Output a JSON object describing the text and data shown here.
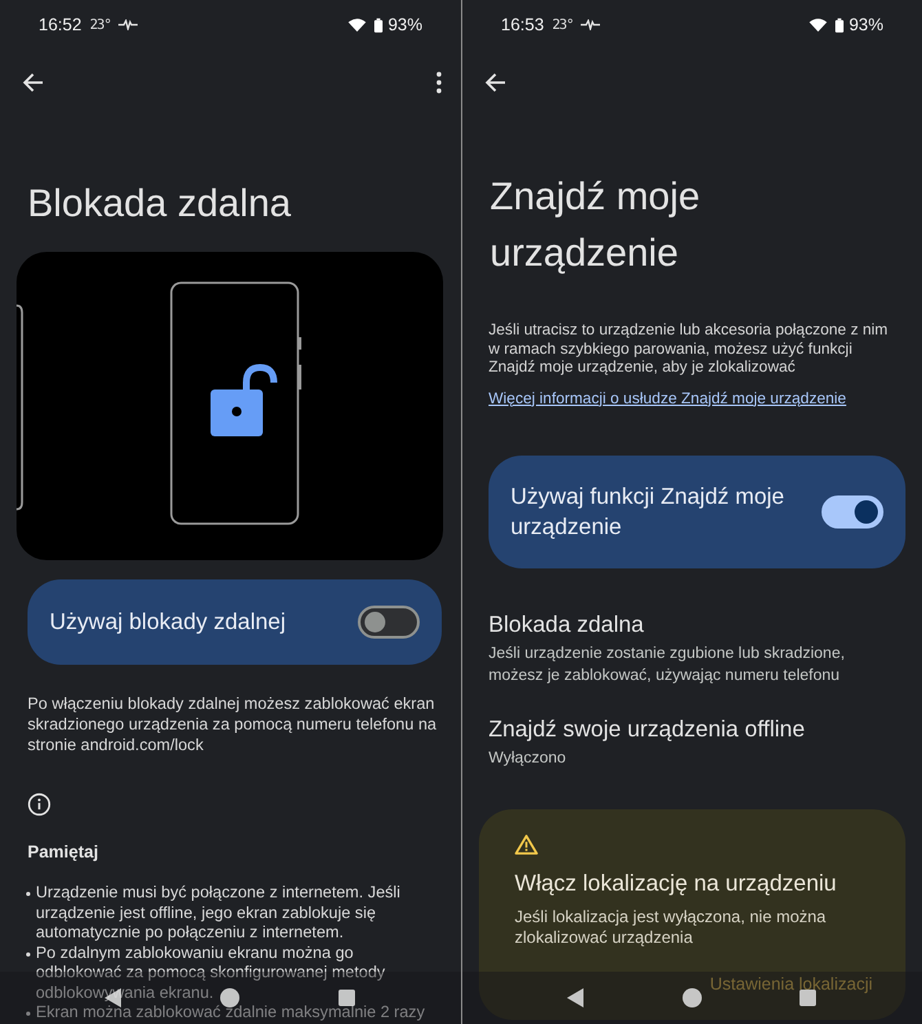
{
  "screens": [
    {
      "status": {
        "time": "16:52",
        "temperature": "23°",
        "battery": "93%"
      },
      "menu_button": true,
      "title": "Blokada zdalna",
      "blocks": [
        {
          "kind": "illustration"
        },
        {
          "kind": "switch",
          "label": "Używaj blokady zdalnej",
          "on": false
        },
        {
          "kind": "text",
          "text": "Po włączeniu blokady zdalnej możesz zablokować ekran skradzionego urządzenia za pomocą numeru telefonu na stronie android.com/lock"
        },
        {
          "kind": "info"
        },
        {
          "kind": "heading",
          "text": "Pamiętaj"
        },
        {
          "kind": "bullets",
          "items": [
            "Urządzenie musi być połączone z internetem. Jeśli urządzenie jest offline, jego ekran zablokuje się automatycznie po połączeniu z internetem.",
            "Po zdalnym zablokowaniu ekranu można go odblokować za pomocą skonfigurowanej metody odblokowywania ekranu.",
            "Ekran można zablokować zdalnie maksymalnie 2 razy"
          ]
        }
      ]
    },
    {
      "status": {
        "time": "16:53",
        "temperature": "23°",
        "battery": "93%"
      },
      "menu_button": false,
      "title": "Znajdź moje urządzenie",
      "blocks": [
        {
          "kind": "small_text",
          "text": "Jeśli utracisz to urządzenie lub akcesoria połączone z nim w ramach szybkiego parowania, możesz użyć funkcji Znajdź moje urządzenie, aby je zlokalizować"
        },
        {
          "kind": "link",
          "text": "Więcej informacji o usłudze Znajdź moje urządzenie"
        },
        {
          "kind": "switch",
          "label": "Używaj funkcji Znajdź moje urządzenie",
          "on": true
        },
        {
          "kind": "setting",
          "title": "Blokada zdalna",
          "summary": "Jeśli urządzenie zostanie zgubione lub skradzione, możesz je zablokować, używając numeru telefonu"
        },
        {
          "kind": "setting",
          "title": "Znajdź swoje urządzenia offline",
          "summary": "Wyłączono"
        },
        {
          "kind": "warning",
          "title": "Włącz lokalizację na urządzeniu",
          "text": "Jeśli lokalizacja jest wyłączona, nie można zlokalizować urządzenia",
          "action": "Ustawienia lokalizacji"
        }
      ]
    }
  ]
}
